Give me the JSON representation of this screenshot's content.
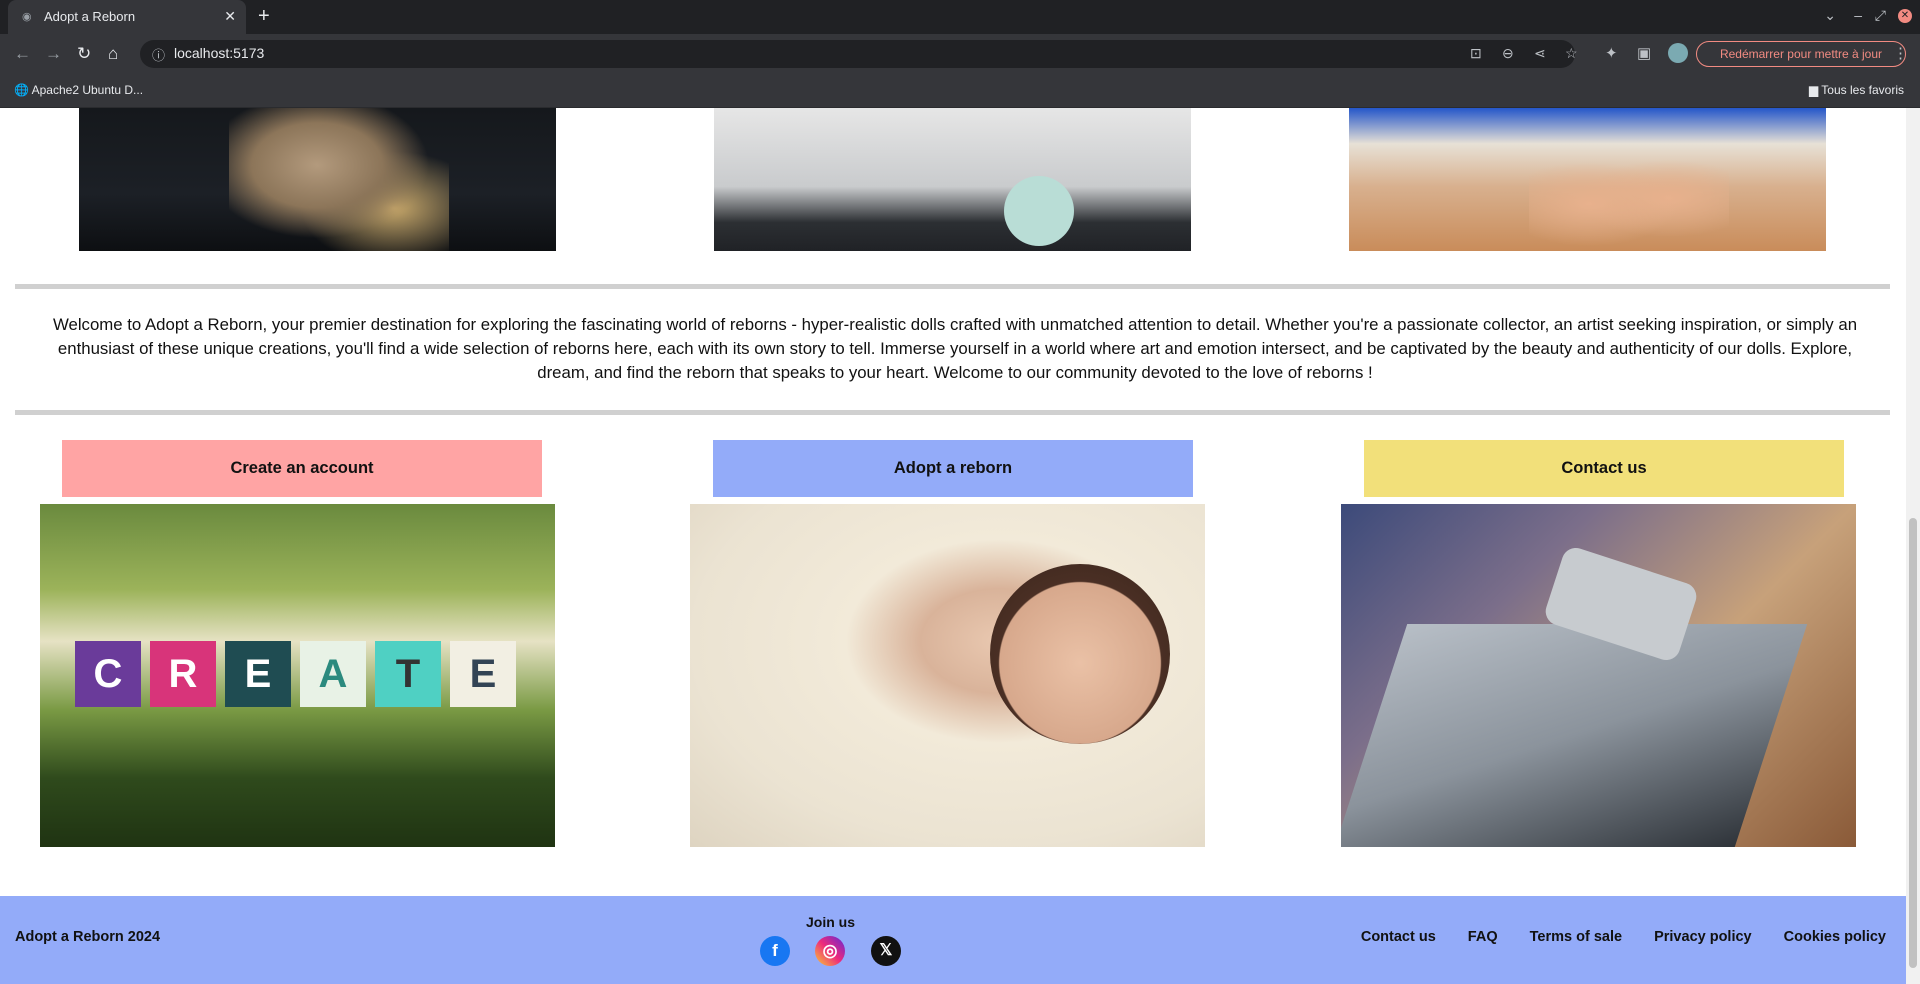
{
  "browser": {
    "tab_title": "Adopt a Reborn",
    "url": "localhost:5173",
    "restart_label": "Redémarrer pour mettre à jour",
    "bookmark_left": "Apache2 Ubuntu D...",
    "bookmark_right": "Tous les favoris"
  },
  "main": {
    "welcome": "Welcome to Adopt a Reborn, your premier destination for exploring the fascinating world of reborns - hyper-realistic dolls crafted with unmatched attention to detail. Whether you're a passionate collector, an artist seeking inspiration, or simply an enthusiast of these unique creations, you'll find a wide selection of reborns here, each with its own story to tell. Immerse yourself in a world where art and emotion intersect, and be captivated by the beauty and authenticity of our dolls. Explore, dream, and find the reborn that speaks to your heart. Welcome to our community devoted to the love of reborns !",
    "cards": [
      {
        "label": "Create an account",
        "color": "#ffa4a4"
      },
      {
        "label": "Adopt a reborn",
        "color": "#93abf9"
      },
      {
        "label": "Contact us",
        "color": "#f2e07a"
      }
    ],
    "create_letters": [
      "C",
      "R",
      "E",
      "A",
      "T",
      "E"
    ]
  },
  "footer": {
    "copyright": "Adopt a Reborn 2024",
    "join": "Join us",
    "links": [
      "Contact us",
      "FAQ",
      "Terms of sale",
      "Privacy policy",
      "Cookies policy"
    ],
    "background": "#93abf9"
  }
}
